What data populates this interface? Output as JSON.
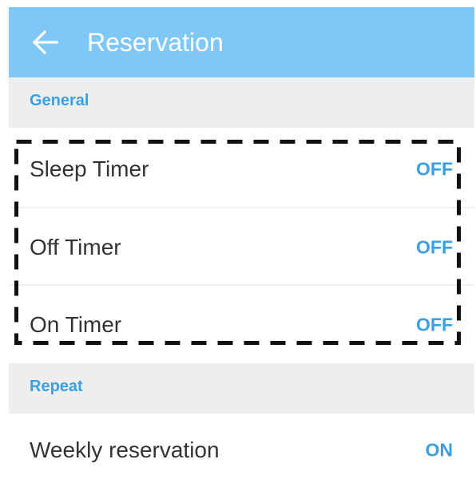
{
  "app_bar": {
    "title": "Reservation",
    "back_icon": "arrow-left-icon",
    "background_color": "#7ec7f7"
  },
  "sections": {
    "general": {
      "header": "General",
      "items": [
        {
          "label": "Sleep Timer",
          "value": "OFF"
        },
        {
          "label": "Off Timer",
          "value": "OFF"
        },
        {
          "label": "On Timer",
          "value": "OFF"
        }
      ]
    },
    "repeat": {
      "header": "Repeat",
      "items": [
        {
          "label": "Weekly reservation",
          "value": "ON"
        }
      ]
    }
  },
  "colors": {
    "accent": "#3aa0e3",
    "section_bg": "#eeeeee",
    "highlight_border": "#111111"
  }
}
